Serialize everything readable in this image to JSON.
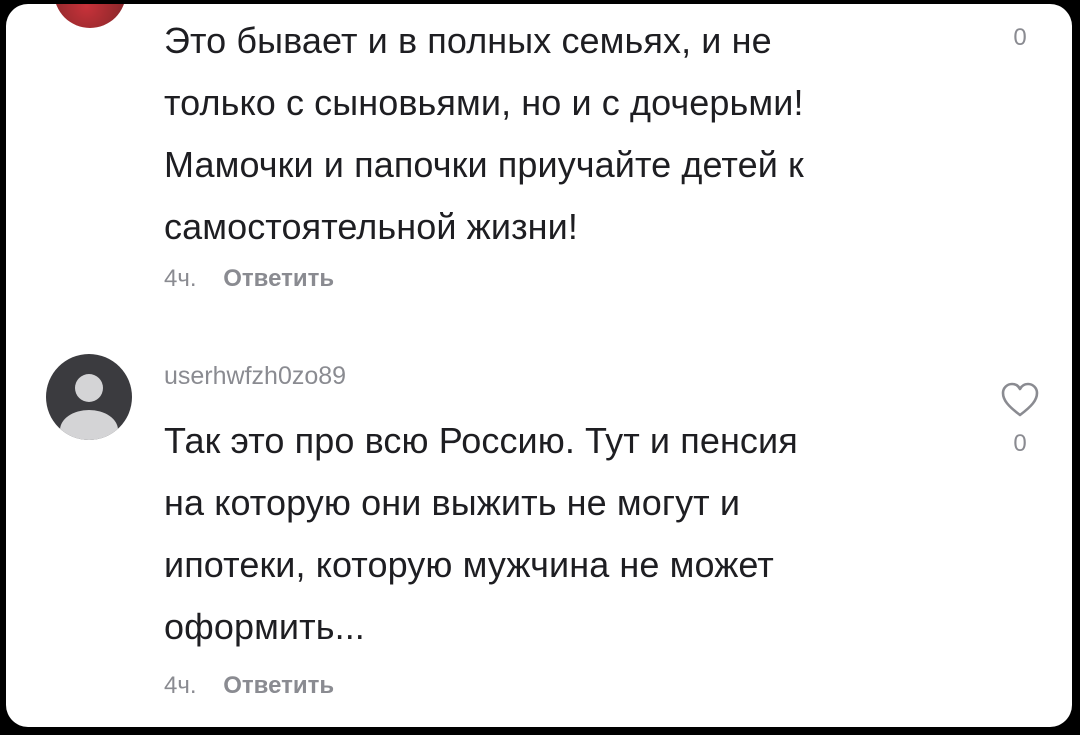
{
  "comments": [
    {
      "text_lines": [
        "Это бывает и в полных семьях, и не",
        "только с сыновьями, но и с дочерьми!",
        "Мамочки и папочки приучайте детей к",
        "самостоятельной жизни!"
      ],
      "time": "4ч.",
      "reply_label": "Ответить",
      "likes": "0",
      "avatar_icon": "user-photo-icon"
    },
    {
      "username": "userhwfzh0zo89",
      "text_lines": [
        "Так это про всю Россию. Тут и пенсия",
        "на которую они выжить не могут и",
        "ипотеки, которую мужчина не может",
        "оформить..."
      ],
      "time": "4ч.",
      "reply_label": "Ответить",
      "likes": "0",
      "avatar_icon": "default-avatar-icon",
      "like_icon": "heart-icon"
    }
  ]
}
